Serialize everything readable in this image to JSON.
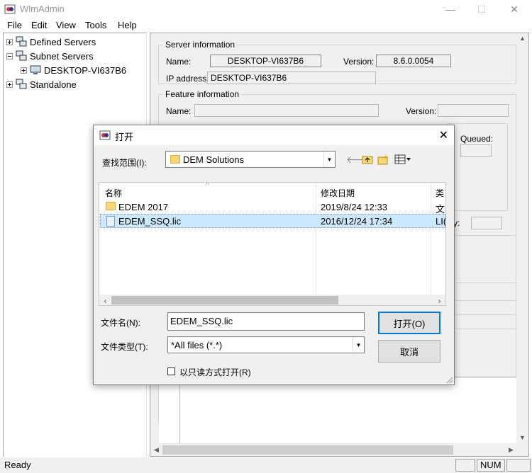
{
  "window": {
    "title": "WlmAdmin",
    "minimize": "—",
    "maximize": "☐",
    "close": "✕"
  },
  "menu": [
    "File",
    "Edit",
    "View",
    "Tools",
    "Help"
  ],
  "tree": {
    "defined_servers": "Defined Servers",
    "subnet_servers": "Subnet Servers",
    "desktop": "DESKTOP-VI637B6",
    "standalone": "Standalone"
  },
  "server_info": {
    "title": "Server information",
    "name_label": "Name:",
    "name_value": "DESKTOP-VI637B6",
    "version_label": "Version:",
    "version_value": "8.6.0.0054",
    "ip_label": "IP address:",
    "ip_value": "DESKTOP-VI637B6"
  },
  "feature_info": {
    "title": "Feature information",
    "name_label": "Name:",
    "version_label": "Version:",
    "queued_label": "Queued:",
    "priority_label": "rity:"
  },
  "status": {
    "text": "Ready",
    "num": "NUM"
  },
  "dialog": {
    "title": "打开",
    "close": "✕",
    "lookin_label": "查找范围(I):",
    "lookin_value": "DEM Solutions",
    "columns": {
      "name": "名称",
      "modified": "修改日期",
      "type": "类"
    },
    "files": [
      {
        "name": "EDEM 2017",
        "date": "2019/8/24 12:33",
        "type": "文",
        "kind": "folder"
      },
      {
        "name": "EDEM_SSQ.lic",
        "date": "2016/12/24 17:34",
        "type": "LI(",
        "kind": "file"
      }
    ],
    "filename_label": "文件名(N):",
    "filename_value": "EDEM_SSQ.lic",
    "filetype_label": "文件类型(T):",
    "filetype_value": "*All files (*.*)",
    "open_button": "打开(O)",
    "cancel_button": "取消",
    "readonly_label": "以只读方式打开(R)"
  }
}
